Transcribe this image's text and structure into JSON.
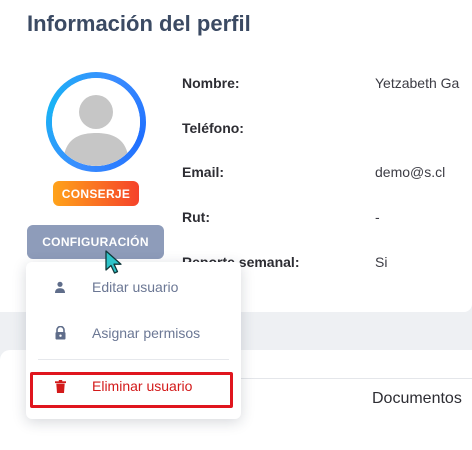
{
  "header": {
    "title": "Información del perfil"
  },
  "profile": {
    "role_badge": "CONSERJE",
    "config_button": "CONFIGURACIÓN",
    "fields": [
      {
        "label": "Nombre:",
        "value": "Yetzabeth Ga"
      },
      {
        "label": "Teléfono:",
        "value": ""
      },
      {
        "label": "Email:",
        "value": "demo@s.cl"
      },
      {
        "label": "Rut:",
        "value": "-"
      },
      {
        "label": "Reporte semanal:",
        "value": "Si"
      }
    ]
  },
  "menu": {
    "items": [
      {
        "label": "Editar usuario",
        "icon": "user-icon"
      },
      {
        "label": "Asignar permisos",
        "icon": "lock-icon"
      },
      {
        "label": "Eliminar usuario",
        "icon": "trash-icon",
        "color": "#d31a1a"
      }
    ]
  },
  "tabs": {
    "documents": "Documentos"
  },
  "colors": {
    "title": "#3b4a63",
    "badge_gradient": [
      "#ffa31a",
      "#f5422a"
    ],
    "config_button": "#8e9cba",
    "danger": "#d31a1a",
    "highlight_border": "#e0161e"
  }
}
